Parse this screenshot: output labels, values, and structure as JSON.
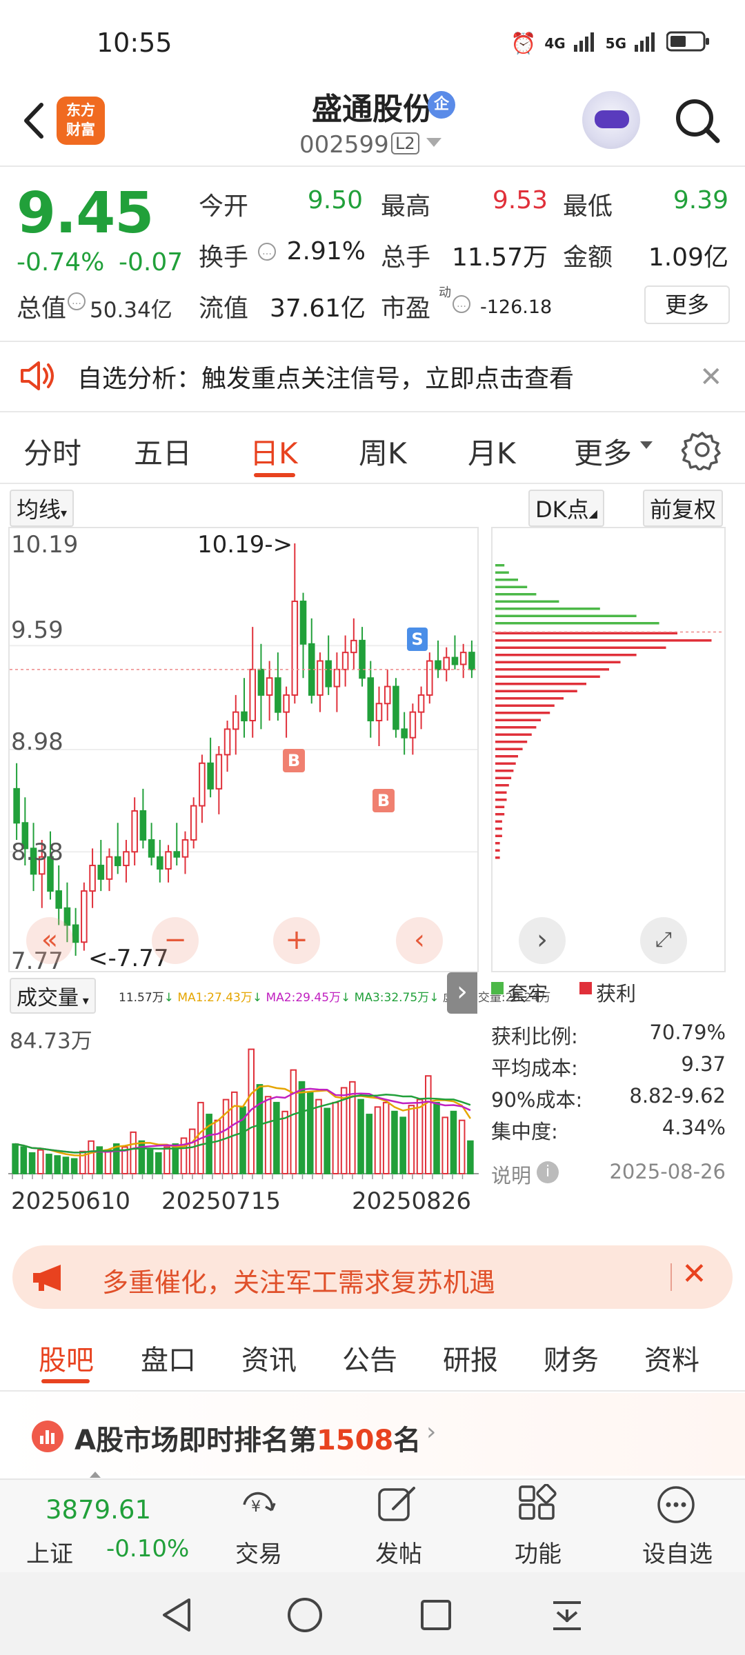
{
  "status_bar": {
    "time": "10:55",
    "net1": "4G",
    "net2": "5G"
  },
  "header": {
    "logo_line1": "东方",
    "logo_line2": "财富",
    "stock_name": "盛通股份",
    "badge": "企",
    "stock_code": "002599",
    "level": "L2"
  },
  "quote": {
    "price": "9.45",
    "change_pct": "-0.74%",
    "change_abs": "-0.07",
    "open_label": "今开",
    "open": "9.50",
    "high_label": "最高",
    "high": "9.53",
    "low_label": "最低",
    "low": "9.39",
    "turnover_label": "换手",
    "turnover": "2.91%",
    "volume_label": "总手",
    "volume": "11.57万",
    "amount_label": "金额",
    "amount": "1.09亿",
    "mktcap_label": "总值",
    "mktcap": "50.34亿",
    "float_label": "流值",
    "float_cap": "37.61亿",
    "pe_label": "市盈",
    "pe_sup": "动",
    "pe": "-126.18",
    "more_label": "更多"
  },
  "alert": {
    "text": "自选分析：触发重点关注信号，立即点击查看"
  },
  "tabs": [
    "分时",
    "五日",
    "日K",
    "周K",
    "月K",
    "更多"
  ],
  "chart_controls": {
    "ma_label": "均线",
    "dk_label": "DK点",
    "adjust_label": "前复权"
  },
  "kline": {
    "y_labels": [
      "10.19",
      "9.59",
      "8.98",
      "8.38",
      "7.77"
    ],
    "max_annot": "10.19->",
    "min_annot": "<-7.77",
    "signal_s": "S",
    "signal_b": "B"
  },
  "volume_legend": {
    "label": "成交量",
    "vol": "11.57万",
    "ma1": "MA1:27.43万",
    "ma2": "MA2:29.45万",
    "ma3": "MA3:32.75万",
    "virtual": "虚拟成交量:28.24万",
    "axis_max": "84.73万"
  },
  "dates": [
    "20250610",
    "20250715",
    "20250826"
  ],
  "chips": {
    "legend_trapped": "套牢",
    "legend_profit": "获利",
    "profit_ratio_label": "获利比例:",
    "profit_ratio": "70.79%",
    "avg_cost_label": "平均成本:",
    "avg_cost": "9.37",
    "cost90_label": "90%成本:",
    "cost90": "8.82-9.62",
    "concentration_label": "集中度:",
    "concentration": "4.34%",
    "explain_label": "说明",
    "date": "2025-08-26"
  },
  "promo": {
    "text": "多重催化，关注军工需求复苏机遇"
  },
  "bottom_tabs": [
    "股吧",
    "盘口",
    "资讯",
    "公告",
    "研报",
    "财务",
    "资料"
  ],
  "rank": {
    "prefix": "A股市场即时排名第",
    "number": "1508",
    "suffix": "名"
  },
  "index_info": {
    "value": "3879.61",
    "name": "上证",
    "change": "-0.10%"
  },
  "bottom_nav": [
    "交易",
    "发帖",
    "功能",
    "设自选"
  ],
  "colors": {
    "up": "#e0303a",
    "down": "#21a03a",
    "accent": "#e8421f"
  },
  "chart_data": [
    {
      "type": "candlestick",
      "title": "",
      "ylim": [
        7.77,
        10.19
      ],
      "y_ticks": [
        10.19,
        9.59,
        8.98,
        8.38,
        7.77
      ],
      "x_ticks": [
        "20250610",
        "20250715",
        "20250826"
      ],
      "ohlc": [
        [
          8.75,
          8.9,
          8.45,
          8.55
        ],
        [
          8.55,
          8.7,
          8.3,
          8.4
        ],
        [
          8.4,
          8.55,
          8.15,
          8.25
        ],
        [
          8.25,
          8.45,
          8.05,
          8.35
        ],
        [
          8.35,
          8.5,
          8.1,
          8.15
        ],
        [
          8.15,
          8.3,
          7.95,
          8.05
        ],
        [
          8.05,
          8.2,
          7.85,
          7.95
        ],
        [
          7.95,
          8.05,
          7.77,
          7.85
        ],
        [
          7.85,
          8.2,
          7.8,
          8.15
        ],
        [
          8.15,
          8.4,
          8.05,
          8.3
        ],
        [
          8.3,
          8.45,
          8.15,
          8.22
        ],
        [
          8.22,
          8.4,
          8.15,
          8.35
        ],
        [
          8.35,
          8.55,
          8.25,
          8.3
        ],
        [
          8.3,
          8.45,
          8.2,
          8.38
        ],
        [
          8.38,
          8.7,
          8.3,
          8.62
        ],
        [
          8.62,
          8.75,
          8.4,
          8.45
        ],
        [
          8.45,
          8.55,
          8.3,
          8.35
        ],
        [
          8.35,
          8.45,
          8.2,
          8.28
        ],
        [
          8.28,
          8.42,
          8.2,
          8.38
        ],
        [
          8.38,
          8.55,
          8.3,
          8.35
        ],
        [
          8.35,
          8.5,
          8.25,
          8.45
        ],
        [
          8.45,
          8.7,
          8.4,
          8.65
        ],
        [
          8.65,
          8.95,
          8.55,
          8.9
        ],
        [
          8.9,
          9.05,
          8.7,
          8.75
        ],
        [
          8.75,
          9.0,
          8.6,
          8.95
        ],
        [
          8.95,
          9.15,
          8.85,
          9.1
        ],
        [
          9.1,
          9.3,
          8.95,
          9.2
        ],
        [
          9.2,
          9.4,
          9.05,
          9.15
        ],
        [
          9.15,
          9.7,
          9.05,
          9.45
        ],
        [
          9.45,
          9.6,
          9.1,
          9.3
        ],
        [
          9.3,
          9.5,
          9.15,
          9.4
        ],
        [
          9.4,
          9.55,
          9.15,
          9.2
        ],
        [
          9.2,
          9.35,
          9.05,
          9.3
        ],
        [
          9.3,
          10.19,
          9.25,
          9.85
        ],
        [
          9.85,
          9.9,
          9.4,
          9.6
        ],
        [
          9.6,
          9.75,
          9.25,
          9.3
        ],
        [
          9.3,
          9.55,
          9.2,
          9.5
        ],
        [
          9.5,
          9.65,
          9.3,
          9.35
        ],
        [
          9.35,
          9.55,
          9.2,
          9.45
        ],
        [
          9.45,
          9.65,
          9.35,
          9.55
        ],
        [
          9.55,
          9.75,
          9.45,
          9.62
        ],
        [
          9.62,
          9.7,
          9.35,
          9.4
        ],
        [
          9.4,
          9.5,
          9.05,
          9.15
        ],
        [
          9.15,
          9.35,
          9.0,
          9.25
        ],
        [
          9.25,
          9.45,
          9.15,
          9.35
        ],
        [
          9.35,
          9.4,
          9.05,
          9.1
        ],
        [
          9.1,
          9.2,
          8.95,
          9.05
        ],
        [
          9.05,
          9.25,
          8.95,
          9.2
        ],
        [
          9.2,
          9.35,
          9.1,
          9.3
        ],
        [
          9.3,
          9.55,
          9.25,
          9.5
        ],
        [
          9.5,
          9.62,
          9.4,
          9.45
        ],
        [
          9.45,
          9.58,
          9.38,
          9.52
        ],
        [
          9.52,
          9.65,
          9.45,
          9.48
        ],
        [
          9.48,
          9.6,
          9.4,
          9.55
        ],
        [
          9.55,
          9.62,
          9.4,
          9.45
        ]
      ]
    },
    {
      "type": "bar",
      "title": "",
      "ylabel": "成交量",
      "ylim": [
        0,
        84.73
      ],
      "volumes": [
        20,
        18,
        14,
        16,
        13,
        12,
        11,
        10,
        15,
        22,
        18,
        16,
        20,
        18,
        28,
        22,
        16,
        14,
        18,
        20,
        24,
        30,
        48,
        40,
        36,
        50,
        55,
        45,
        84,
        60,
        52,
        48,
        42,
        70,
        62,
        55,
        50,
        44,
        48,
        58,
        62,
        50,
        40,
        45,
        48,
        42,
        38,
        46,
        50,
        66,
        48,
        38,
        42,
        36,
        22
      ]
    },
    {
      "type": "bar",
      "title": "",
      "orientation": "horizontal",
      "series": [
        {
          "name": "套牢",
          "values": [
            4,
            6,
            10,
            14,
            18,
            28,
            46,
            62,
            72
          ]
        },
        {
          "name": "获利",
          "values": [
            80,
            95,
            75,
            62,
            55,
            50,
            46,
            40,
            36,
            30,
            26,
            24,
            20,
            18,
            16,
            14,
            12,
            10,
            9,
            8,
            7,
            6,
            5,
            5,
            4,
            4,
            3,
            3,
            3,
            2,
            2,
            2
          ]
        }
      ]
    }
  ]
}
